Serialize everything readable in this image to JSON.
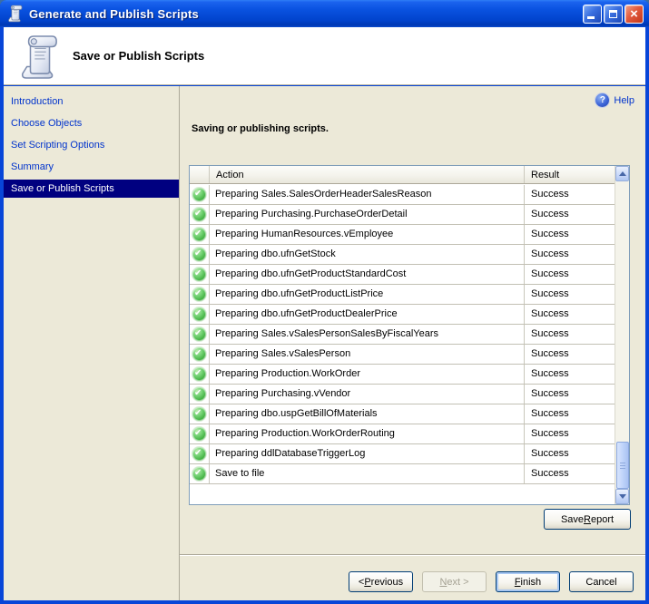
{
  "window": {
    "title": "Generate and Publish Scripts"
  },
  "header": {
    "title": "Save or Publish Scripts"
  },
  "sidebar": {
    "items": [
      {
        "label": "Introduction",
        "selected": false
      },
      {
        "label": "Choose Objects",
        "selected": false
      },
      {
        "label": "Set Scripting Options",
        "selected": false
      },
      {
        "label": "Summary",
        "selected": false
      },
      {
        "label": "Save or Publish Scripts",
        "selected": true
      }
    ]
  },
  "content": {
    "help_label": "Help",
    "status_text": "Saving or publishing scripts.",
    "table": {
      "columns": {
        "action": "Action",
        "result": "Result"
      },
      "rows": [
        {
          "action": "Preparing Sales.SalesOrderHeaderSalesReason",
          "result": "Success"
        },
        {
          "action": "Preparing Purchasing.PurchaseOrderDetail",
          "result": "Success"
        },
        {
          "action": "Preparing HumanResources.vEmployee",
          "result": "Success"
        },
        {
          "action": "Preparing dbo.ufnGetStock",
          "result": "Success"
        },
        {
          "action": "Preparing dbo.ufnGetProductStandardCost",
          "result": "Success"
        },
        {
          "action": "Preparing dbo.ufnGetProductListPrice",
          "result": "Success"
        },
        {
          "action": "Preparing dbo.ufnGetProductDealerPrice",
          "result": "Success"
        },
        {
          "action": "Preparing Sales.vSalesPersonSalesByFiscalYears",
          "result": "Success"
        },
        {
          "action": "Preparing Sales.vSalesPerson",
          "result": "Success"
        },
        {
          "action": "Preparing Production.WorkOrder",
          "result": "Success"
        },
        {
          "action": "Preparing Purchasing.vVendor",
          "result": "Success"
        },
        {
          "action": "Preparing dbo.uspGetBillOfMaterials",
          "result": "Success"
        },
        {
          "action": "Preparing Production.WorkOrderRouting",
          "result": "Success"
        },
        {
          "action": "Preparing ddlDatabaseTriggerLog",
          "result": "Success"
        },
        {
          "action": "Save to file",
          "result": "Success"
        }
      ]
    },
    "save_report": {
      "pre": "Save ",
      "key": "R",
      "post": "eport"
    }
  },
  "footer": {
    "previous": {
      "pre": "< ",
      "key": "P",
      "post": "revious"
    },
    "next": {
      "pre": "",
      "key": "N",
      "post": "ext >"
    },
    "finish": {
      "pre": "",
      "key": "F",
      "post": "inish"
    },
    "cancel_label": "Cancel"
  },
  "colors": {
    "titlebar_blue": "#0846D8",
    "selection_navy": "#000080",
    "link_blue": "#0033CC",
    "success_green": "#3DAE3D",
    "content_bg": "#ECE9D8",
    "table_border": "#7F9DB9"
  }
}
